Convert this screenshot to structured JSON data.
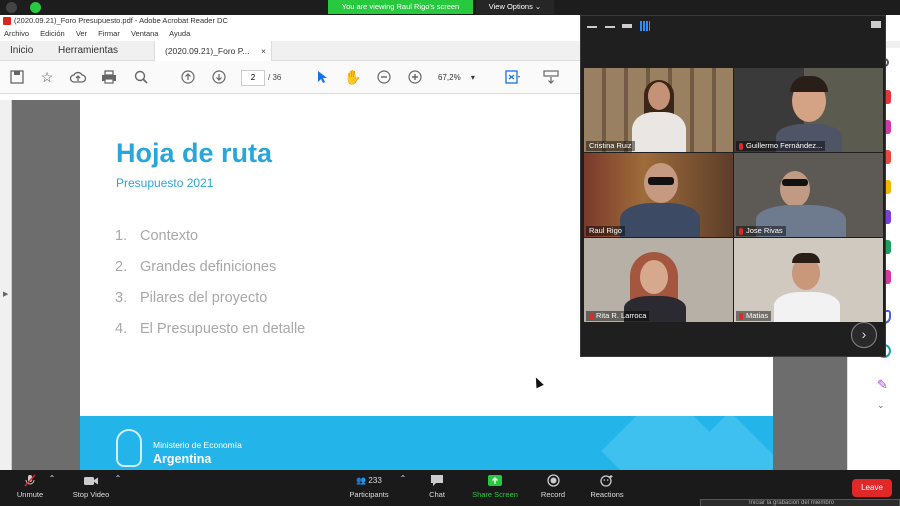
{
  "zoom_top": {
    "viewing_banner": "You are viewing Raul Rigo's screen",
    "view_options": "View Options"
  },
  "acrobat": {
    "title": "(2020.09.21)_Foro Presupuesto.pdf - Adobe Acrobat Reader DC",
    "menu": [
      "Archivo",
      "Edición",
      "Ver",
      "Firmar",
      "Ventana",
      "Ayuda"
    ],
    "tabs": {
      "home": "Inicio",
      "tools": "Herramientas",
      "doc": "(2020.09.21)_Foro P...",
      "close": "×"
    },
    "page_current": "2",
    "page_total": "/ 36",
    "zoom": "67,2%"
  },
  "slide": {
    "title": "Hoja de ruta",
    "subtitle": "Presupuesto 2021",
    "agenda": [
      {
        "num": "1.",
        "text": "Contexto"
      },
      {
        "num": "2.",
        "text": "Grandes definiciones"
      },
      {
        "num": "3.",
        "text": "Pilares del proyecto"
      },
      {
        "num": "4.",
        "text": "El Presupuesto en detalle"
      }
    ],
    "footer_ministry": "Ministerio de Economía",
    "footer_country": "Argentina"
  },
  "participants_panel": {
    "tiles": [
      {
        "name": "Cristina Ruiz",
        "muted": false
      },
      {
        "name": "Guillermo Fernández...",
        "muted": true
      },
      {
        "name": "Raul Rigo",
        "muted": false,
        "active": true
      },
      {
        "name": "Jose Rivas",
        "muted": true
      },
      {
        "name": "Rita R. Larroca",
        "muted": true
      },
      {
        "name": "Matias",
        "muted": true
      }
    ],
    "next": "›"
  },
  "zoom_bar": {
    "unmute": "Unmute",
    "stop_video": "Stop Video",
    "participants": "Participants",
    "participants_count": "233",
    "chat": "Chat",
    "share_screen": "Share Screen",
    "record": "Record",
    "reactions": "Reactions",
    "leave": "Leave",
    "toast": "Iniciar la grabación del miembro"
  },
  "colors": {
    "accent_blue": "#29a6da",
    "zoom_green": "#27c93f",
    "leave_red": "#e02828",
    "active_speaker": "#d4c430"
  }
}
